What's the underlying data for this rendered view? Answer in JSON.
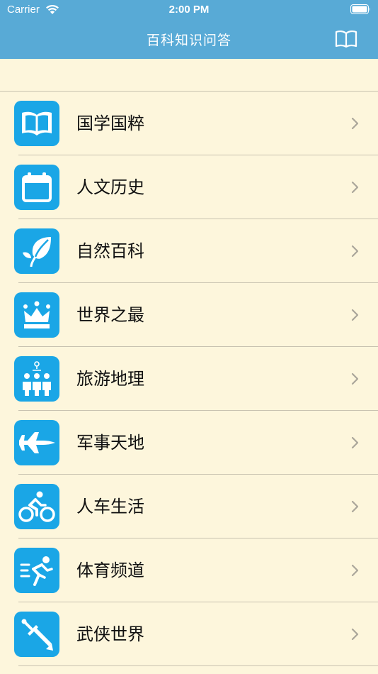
{
  "status_bar": {
    "carrier": "Carrier",
    "time": "2:00 PM"
  },
  "nav": {
    "title": "百科知识问答"
  },
  "colors": {
    "header": "#58aad6",
    "background": "#fdf6dc",
    "icon_tile": "#1aa6e6"
  },
  "categories": [
    {
      "label": "国学国粹",
      "icon": "open-book-icon"
    },
    {
      "label": "人文历史",
      "icon": "calendar-icon"
    },
    {
      "label": "自然百科",
      "icon": "leaf-icon"
    },
    {
      "label": "世界之最",
      "icon": "crown-icon"
    },
    {
      "label": "旅游地理",
      "icon": "group-people-icon"
    },
    {
      "label": "军事天地",
      "icon": "fighter-jet-icon"
    },
    {
      "label": "人车生活",
      "icon": "cyclist-icon"
    },
    {
      "label": "体育频道",
      "icon": "sprinter-icon"
    },
    {
      "label": "武侠世界",
      "icon": "sword-icon"
    }
  ]
}
